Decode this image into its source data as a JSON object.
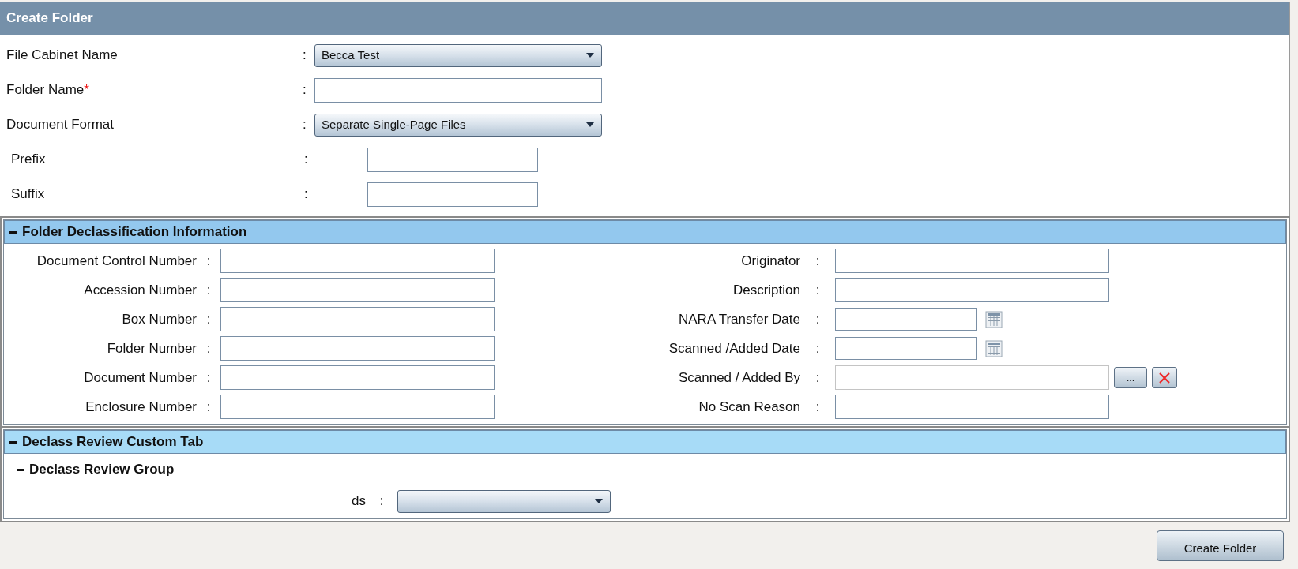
{
  "title": "Create Folder",
  "fields": [
    {
      "label": "File Cabinet Name",
      "separator": ":",
      "kind": "dropdown",
      "value": "Becca Test"
    },
    {
      "label": "Folder Name",
      "required_mark": "*",
      "separator": ":",
      "kind": "text"
    },
    {
      "label": "Document Format",
      "separator": ":",
      "kind": "dropdown",
      "value": "Separate Single-Page Files"
    }
  ],
  "format_fields": [
    {
      "label": "Prefix",
      "separator": ":",
      "kind": "text"
    },
    {
      "label": "Suffix",
      "separator": ":",
      "kind": "text"
    }
  ],
  "declassification": {
    "title": "Folder Declassification Information",
    "expanded": true,
    "left": [
      {
        "label": "Document Control Number",
        "separator": ":",
        "kind": "text"
      },
      {
        "label": "Accession Number",
        "separator": ":",
        "kind": "text"
      },
      {
        "label": "Box Number",
        "separator": ":",
        "kind": "text"
      },
      {
        "label": "Folder Number",
        "separator": ":",
        "kind": "text"
      },
      {
        "label": "Document Number",
        "separator": ":",
        "kind": "text"
      },
      {
        "label": "Enclosure Number",
        "separator": ":",
        "kind": "text"
      }
    ],
    "right": [
      {
        "label": "Originator",
        "separator": ":",
        "kind": "text"
      },
      {
        "label": "Description",
        "separator": ":",
        "kind": "text"
      },
      {
        "label": "NARA Transfer Date",
        "separator": ":",
        "kind": "date"
      },
      {
        "label": "Scanned /Added Date",
        "separator": ":",
        "kind": "date"
      },
      {
        "label": "Scanned / Added By",
        "separator": ":",
        "kind": "lookup",
        "browse_label": "..."
      },
      {
        "label": "No Scan Reason",
        "separator": ":",
        "kind": "text"
      }
    ]
  },
  "custom_tab": {
    "title": "Declass Review Custom Tab",
    "expanded": true,
    "groups": [
      {
        "title": "Declass Review Group",
        "expanded": true,
        "fields": [
          {
            "label": "ds",
            "separator": ":",
            "kind": "dropdown"
          }
        ]
      }
    ]
  },
  "submit_button": "Create Folder"
}
